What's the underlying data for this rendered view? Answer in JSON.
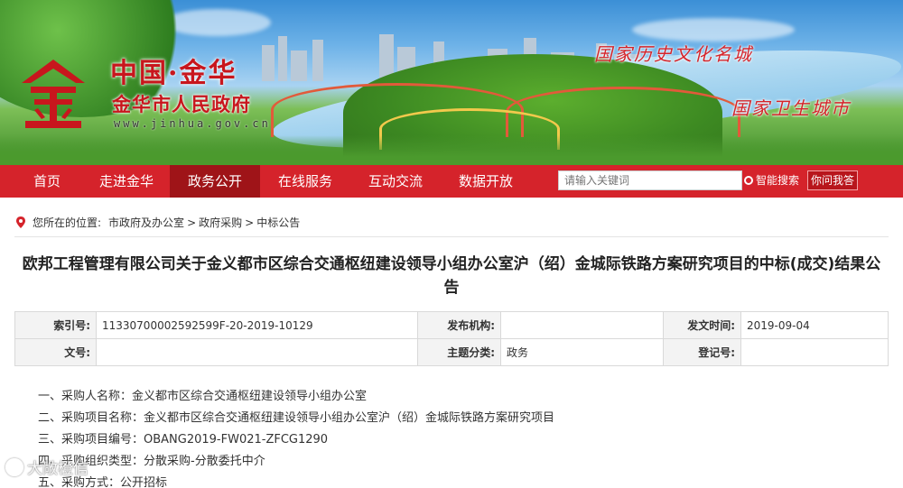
{
  "header": {
    "title": "中国·金华",
    "subtitle": "金华市人民政府",
    "url": "www.jinhua.gov.cn",
    "logo": "jin-character-logo",
    "slogans": [
      "国家历史文化名城",
      "国家卫生城市"
    ]
  },
  "nav": {
    "items": [
      {
        "label": "首页"
      },
      {
        "label": "走进金华"
      },
      {
        "label": "政务公开"
      },
      {
        "label": "在线服务"
      },
      {
        "label": "互动交流"
      },
      {
        "label": "数据开放"
      }
    ],
    "active_index": 2
  },
  "search": {
    "placeholder": "请输入关键词",
    "button_label": "智能搜索",
    "ask_label": "你问我答"
  },
  "breadcrumb": {
    "prefix": "您所在的位置:",
    "items": [
      "市政府及办公室",
      "政府采购",
      "中标公告"
    ],
    "separator": ">"
  },
  "article": {
    "title": "欧邦工程管理有限公司关于金义都市区综合交通枢纽建设领导小组办公室沪（绍）金城际铁路方案研究项目的中标(成交)结果公告"
  },
  "meta": {
    "row1": [
      {
        "label": "索引号:",
        "value": "11330700002592599F-20-2019-10129"
      },
      {
        "label": "发布机构:",
        "value": ""
      },
      {
        "label": "发文时间:",
        "value": "2019-09-04"
      }
    ],
    "row2": [
      {
        "label": "文号:",
        "value": ""
      },
      {
        "label": "主题分类:",
        "value": "政务"
      },
      {
        "label": "登记号:",
        "value": ""
      }
    ]
  },
  "content": {
    "lines": [
      "一、采购人名称：金义都市区综合交通枢纽建设领导小组办公室",
      "二、采购项目名称：金义都市区综合交通枢纽建设领导小组办公室沪（绍）金城际铁路方案研究项目",
      "三、采购项目编号：OBANG2019-FW021-ZFCG1290",
      "四、采购组织类型：分散采购-分散委托中介",
      "五、采购方式：公开招标"
    ]
  },
  "watermark": {
    "text": "大敞橙信"
  },
  "colors": {
    "nav_bg": "#d5232b",
    "nav_active": "#9f1418",
    "title_red": "#c8161d"
  }
}
